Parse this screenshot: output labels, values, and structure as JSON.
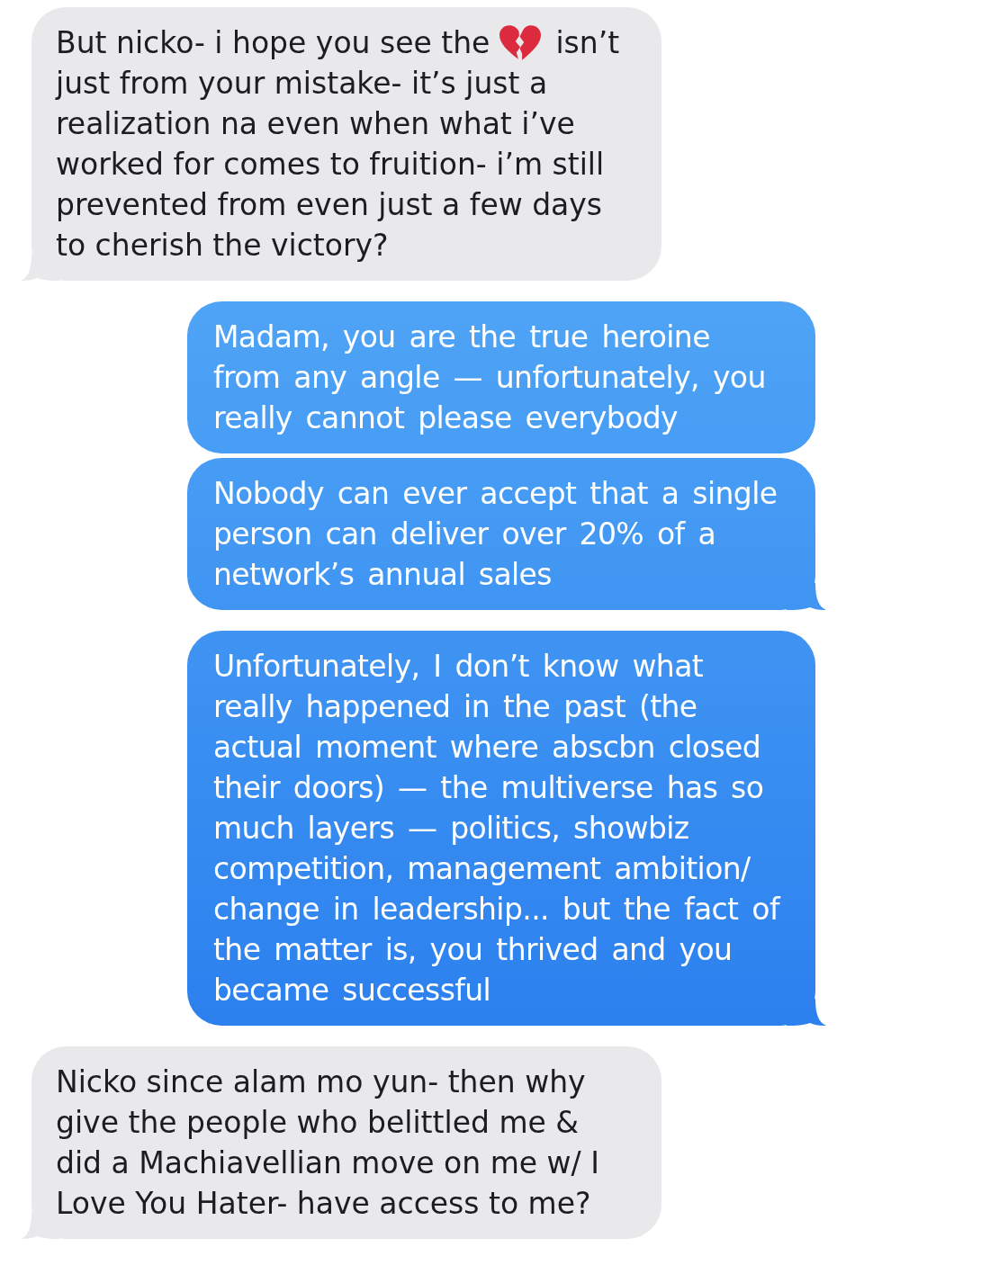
{
  "conversation": {
    "messages": [
      {
        "kind": "received",
        "tail": true,
        "text_before_icon": "But nicko- i hope you see the",
        "text_after_icon": "isn’t",
        "text": "just from your mistake- it’s just a realization na even when what i’ve worked for comes to fruition- i’m still prevented from even just a few days to cherish the victory?"
      },
      {
        "kind": "sent",
        "tail": false,
        "text": "Madam, you are the true heroine from any angle — unfortunately, you really cannot please everybody"
      },
      {
        "kind": "sent",
        "tail": true,
        "text": "Nobody can ever accept that a single person can deliver over 20% of a network’s annual sales"
      },
      {
        "kind": "sent",
        "tail": true,
        "text": "Unfortunately, I don’t know what really happened in the past (the actual moment where abscbn closed their doors) — the multiverse has so much layers — politics, showbiz competition, management ambition/ change in leadership... but the fact of the matter is, you thrived and you became successful"
      },
      {
        "kind": "received",
        "tail": true,
        "text": "Nicko since alam mo yun- then why give the people who belittled me & did a Machiavellian move on me w/ I Love You Hater- have access to me?"
      }
    ]
  }
}
